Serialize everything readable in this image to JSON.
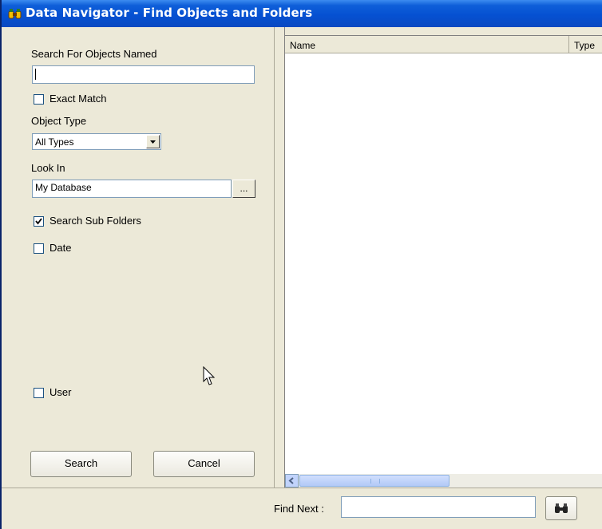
{
  "window": {
    "title": "Data Navigator - Find Objects and Folders",
    "title_icon": "binoculars-icon"
  },
  "search": {
    "name_label": "Search For Objects Named",
    "name_value": "",
    "exact_match_label": "Exact Match",
    "exact_match_checked": false,
    "object_type_label": "Object Type",
    "object_type_value": "All Types",
    "look_in_label": "Look In",
    "look_in_value": "My Database",
    "browse_label": "...",
    "sub_folders_label": "Search Sub Folders",
    "sub_folders_checked": true,
    "date_label": "Date",
    "date_checked": false,
    "user_label": "User",
    "user_checked": false,
    "search_button": "Search",
    "cancel_button": "Cancel"
  },
  "results": {
    "columns": [
      "Name",
      "Type"
    ],
    "rows": []
  },
  "find_next": {
    "label": "Find Next :",
    "value": "",
    "button_icon": "binoculars-icon"
  }
}
